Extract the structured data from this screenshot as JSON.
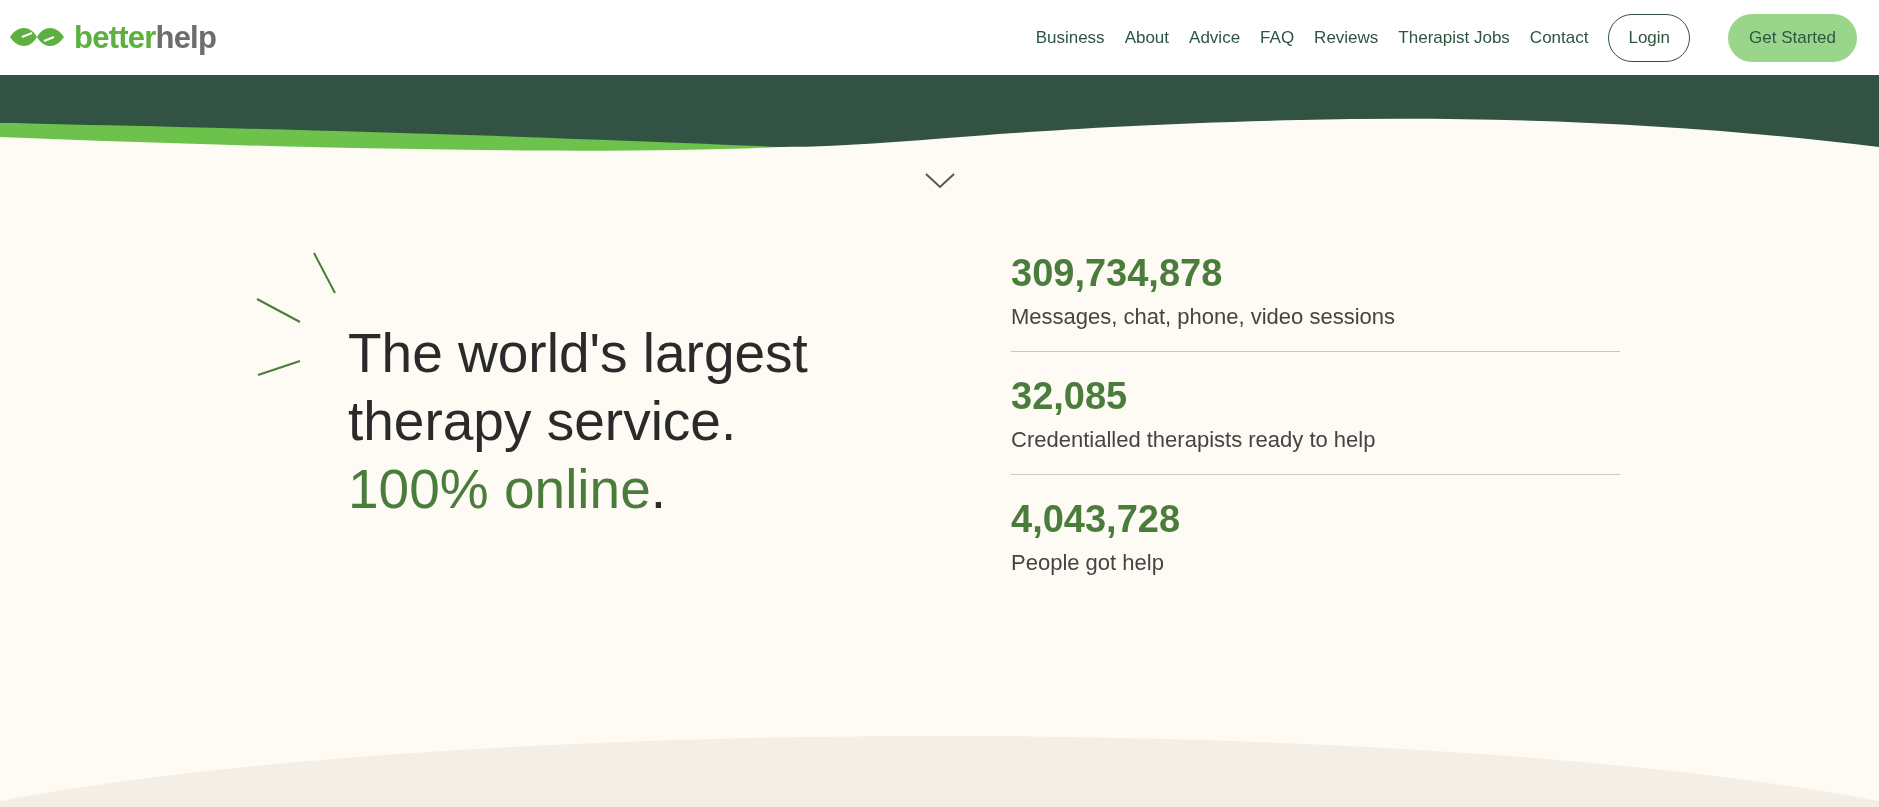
{
  "logo": {
    "part1": "better",
    "part2": "help"
  },
  "nav": {
    "links": [
      "Business",
      "About",
      "Advice",
      "FAQ",
      "Reviews",
      "Therapist Jobs",
      "Contact"
    ],
    "login": "Login",
    "cta": "Get Started"
  },
  "hero": {
    "lines": [
      "The world's largest",
      "therapy service."
    ],
    "highlight": "100% online",
    "suffix": "."
  },
  "stats": [
    {
      "number": "309,734,878",
      "label": "Messages, chat, phone, video sessions"
    },
    {
      "number": "32,085",
      "label": "Credentialled therapists ready to help"
    },
    {
      "number": "4,043,728",
      "label": "People got help"
    }
  ]
}
